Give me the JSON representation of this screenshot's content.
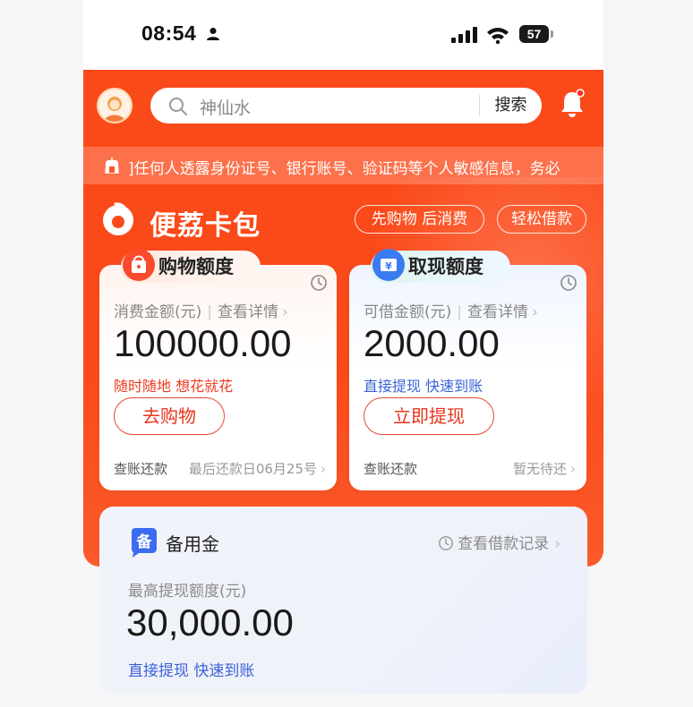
{
  "status": {
    "time": "08:54",
    "battery": "57"
  },
  "search": {
    "placeholder": "神仙水",
    "button": "搜索"
  },
  "notice": {
    "text": "]任何人透露身份证号、银行账号、验证码等个人敏感信息，务必"
  },
  "brand": {
    "name": "便荔卡包"
  },
  "pills": [
    "先购物 后消费",
    "轻松借款"
  ],
  "shopping": {
    "tab": "购物额度",
    "sub_label": "消费金额(元)",
    "detail": "查看详情",
    "amount": "100000.00",
    "slogan": "随时随地 想花就花",
    "button": "去购物",
    "foot_left": "查账还款",
    "foot_right": "最后还款日06月25号"
  },
  "cash": {
    "tab": "取现额度",
    "sub_label": "可借金额(元)",
    "detail": "查看详情",
    "amount": "2000.00",
    "slogan": "直接提现 快速到账",
    "button": "立即提现",
    "foot_left": "查账还款",
    "foot_right": "暂无待还"
  },
  "reserve": {
    "title": "备用金",
    "link": "查看借款记录",
    "sub_label": "最高提现额度(元)",
    "amount": "30,000.00",
    "slogan": "直接提现 快速到账"
  },
  "colors": {
    "brand_orange": "#fb4a19",
    "accent_red": "#e8341c",
    "accent_blue": "#3a62d8"
  }
}
